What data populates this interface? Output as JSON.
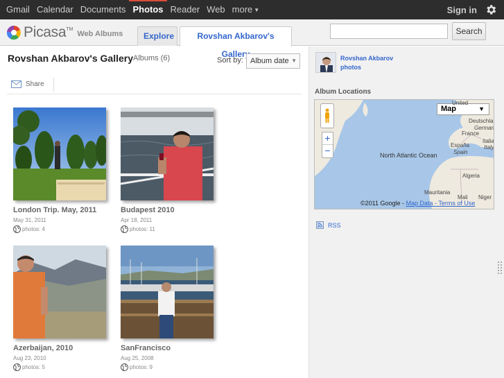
{
  "topbar": {
    "links": [
      {
        "label": "Gmail",
        "active": false
      },
      {
        "label": "Calendar",
        "active": false
      },
      {
        "label": "Documents",
        "active": false
      },
      {
        "label": "Photos",
        "active": true
      },
      {
        "label": "Reader",
        "active": false
      },
      {
        "label": "Web",
        "active": false
      }
    ],
    "more_label": "more",
    "signin_label": "Sign in",
    "settings_icon": "gear-icon"
  },
  "header": {
    "brand": "Picasa",
    "brand_tm": "TM",
    "sub_brand": "Web Albums",
    "tabs": {
      "explore": "Explore",
      "gallery": "Rovshan Akbarov's Gallery"
    },
    "search_value": "",
    "search_button": "Search"
  },
  "main": {
    "title": "Rovshan Akbarov's Gallery",
    "albums_count": "Albums (6)",
    "sort_label": "Sort by:",
    "sort_value": "Album date",
    "share_label": "Share",
    "albums": [
      {
        "name": "London Trip. May, 2011",
        "date": "May 31, 2011",
        "photos": "photos: 4"
      },
      {
        "name": "Budapest 2010",
        "date": "Apr 18, 2011",
        "photos": "photos: 11"
      },
      {
        "name": "Azerbaijan, 2010",
        "date": "Aug 23, 2010",
        "photos": "photos: 5"
      },
      {
        "name": "SanFrancisco",
        "date": "Aug 25, 2008",
        "photos": "photos: 9"
      }
    ]
  },
  "sidebar": {
    "owner_name": "Rovshan Akbarov",
    "owner_photos_link": "photos",
    "locations_title": "Album Locations",
    "map": {
      "type_select": "Map",
      "zoom_in": "+",
      "zoom_out": "−",
      "labels": {
        "united": "United",
        "deutschland": "Deutschla",
        "german": "German",
        "france": "France",
        "italia": "Italia",
        "italy": "Italy",
        "espana": "España",
        "spain": "Spain",
        "ocean": "North Atlantic Ocean",
        "algeria": "Algeria",
        "mauritania": "Mauritania",
        "mali": "Mali",
        "niger": "Niger"
      },
      "copyright": "©2011 Google - ",
      "map_data": "Map Data",
      "terms": " - Terms of Use"
    },
    "rss_label": "RSS"
  },
  "colors": {
    "link_blue": "#3366cc",
    "topbar_bg": "#2d2d2d",
    "active_red": "#dd4b39"
  }
}
